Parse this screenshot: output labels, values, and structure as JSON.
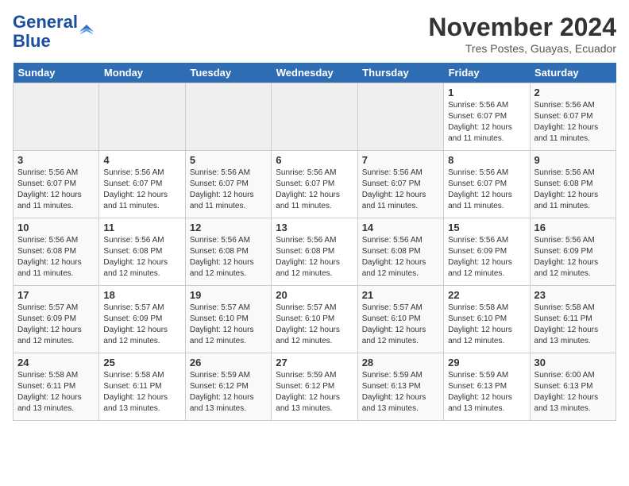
{
  "header": {
    "logo_line1": "General",
    "logo_line2": "Blue",
    "month_title": "November 2024",
    "subtitle": "Tres Postes, Guayas, Ecuador"
  },
  "days_of_week": [
    "Sunday",
    "Monday",
    "Tuesday",
    "Wednesday",
    "Thursday",
    "Friday",
    "Saturday"
  ],
  "weeks": [
    [
      {
        "num": "",
        "info": ""
      },
      {
        "num": "",
        "info": ""
      },
      {
        "num": "",
        "info": ""
      },
      {
        "num": "",
        "info": ""
      },
      {
        "num": "",
        "info": ""
      },
      {
        "num": "1",
        "info": "Sunrise: 5:56 AM\nSunset: 6:07 PM\nDaylight: 12 hours and 11 minutes."
      },
      {
        "num": "2",
        "info": "Sunrise: 5:56 AM\nSunset: 6:07 PM\nDaylight: 12 hours and 11 minutes."
      }
    ],
    [
      {
        "num": "3",
        "info": "Sunrise: 5:56 AM\nSunset: 6:07 PM\nDaylight: 12 hours and 11 minutes."
      },
      {
        "num": "4",
        "info": "Sunrise: 5:56 AM\nSunset: 6:07 PM\nDaylight: 12 hours and 11 minutes."
      },
      {
        "num": "5",
        "info": "Sunrise: 5:56 AM\nSunset: 6:07 PM\nDaylight: 12 hours and 11 minutes."
      },
      {
        "num": "6",
        "info": "Sunrise: 5:56 AM\nSunset: 6:07 PM\nDaylight: 12 hours and 11 minutes."
      },
      {
        "num": "7",
        "info": "Sunrise: 5:56 AM\nSunset: 6:07 PM\nDaylight: 12 hours and 11 minutes."
      },
      {
        "num": "8",
        "info": "Sunrise: 5:56 AM\nSunset: 6:07 PM\nDaylight: 12 hours and 11 minutes."
      },
      {
        "num": "9",
        "info": "Sunrise: 5:56 AM\nSunset: 6:08 PM\nDaylight: 12 hours and 11 minutes."
      }
    ],
    [
      {
        "num": "10",
        "info": "Sunrise: 5:56 AM\nSunset: 6:08 PM\nDaylight: 12 hours and 11 minutes."
      },
      {
        "num": "11",
        "info": "Sunrise: 5:56 AM\nSunset: 6:08 PM\nDaylight: 12 hours and 12 minutes."
      },
      {
        "num": "12",
        "info": "Sunrise: 5:56 AM\nSunset: 6:08 PM\nDaylight: 12 hours and 12 minutes."
      },
      {
        "num": "13",
        "info": "Sunrise: 5:56 AM\nSunset: 6:08 PM\nDaylight: 12 hours and 12 minutes."
      },
      {
        "num": "14",
        "info": "Sunrise: 5:56 AM\nSunset: 6:08 PM\nDaylight: 12 hours and 12 minutes."
      },
      {
        "num": "15",
        "info": "Sunrise: 5:56 AM\nSunset: 6:09 PM\nDaylight: 12 hours and 12 minutes."
      },
      {
        "num": "16",
        "info": "Sunrise: 5:56 AM\nSunset: 6:09 PM\nDaylight: 12 hours and 12 minutes."
      }
    ],
    [
      {
        "num": "17",
        "info": "Sunrise: 5:57 AM\nSunset: 6:09 PM\nDaylight: 12 hours and 12 minutes."
      },
      {
        "num": "18",
        "info": "Sunrise: 5:57 AM\nSunset: 6:09 PM\nDaylight: 12 hours and 12 minutes."
      },
      {
        "num": "19",
        "info": "Sunrise: 5:57 AM\nSunset: 6:10 PM\nDaylight: 12 hours and 12 minutes."
      },
      {
        "num": "20",
        "info": "Sunrise: 5:57 AM\nSunset: 6:10 PM\nDaylight: 12 hours and 12 minutes."
      },
      {
        "num": "21",
        "info": "Sunrise: 5:57 AM\nSunset: 6:10 PM\nDaylight: 12 hours and 12 minutes."
      },
      {
        "num": "22",
        "info": "Sunrise: 5:58 AM\nSunset: 6:10 PM\nDaylight: 12 hours and 12 minutes."
      },
      {
        "num": "23",
        "info": "Sunrise: 5:58 AM\nSunset: 6:11 PM\nDaylight: 12 hours and 13 minutes."
      }
    ],
    [
      {
        "num": "24",
        "info": "Sunrise: 5:58 AM\nSunset: 6:11 PM\nDaylight: 12 hours and 13 minutes."
      },
      {
        "num": "25",
        "info": "Sunrise: 5:58 AM\nSunset: 6:11 PM\nDaylight: 12 hours and 13 minutes."
      },
      {
        "num": "26",
        "info": "Sunrise: 5:59 AM\nSunset: 6:12 PM\nDaylight: 12 hours and 13 minutes."
      },
      {
        "num": "27",
        "info": "Sunrise: 5:59 AM\nSunset: 6:12 PM\nDaylight: 12 hours and 13 minutes."
      },
      {
        "num": "28",
        "info": "Sunrise: 5:59 AM\nSunset: 6:13 PM\nDaylight: 12 hours and 13 minutes."
      },
      {
        "num": "29",
        "info": "Sunrise: 5:59 AM\nSunset: 6:13 PM\nDaylight: 12 hours and 13 minutes."
      },
      {
        "num": "30",
        "info": "Sunrise: 6:00 AM\nSunset: 6:13 PM\nDaylight: 12 hours and 13 minutes."
      }
    ]
  ]
}
